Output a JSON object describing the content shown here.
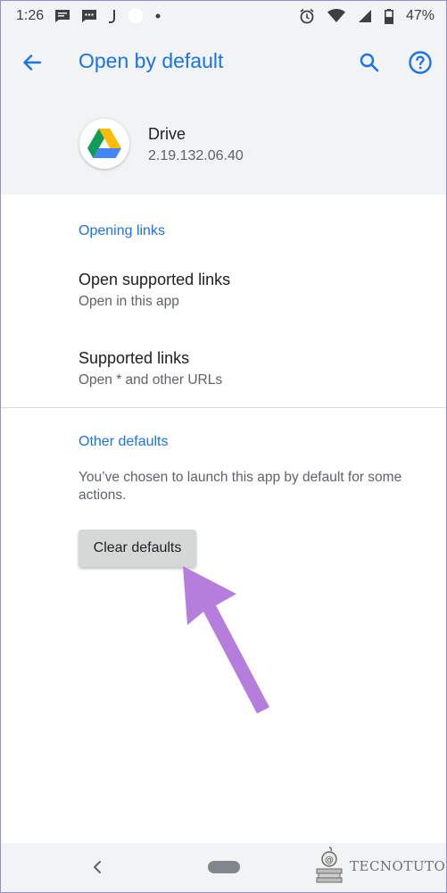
{
  "status_bar": {
    "time": "1:26",
    "battery": "47%",
    "icons": [
      "message-icon",
      "chat-icon",
      "j-icon",
      "circle-icon",
      "dot-icon",
      "alarm-icon",
      "wifi-icon",
      "signal-icon",
      "battery-icon"
    ]
  },
  "header": {
    "title": "Open by default"
  },
  "app": {
    "name": "Drive",
    "version": "2.19.132.06.40"
  },
  "sections": {
    "opening_links": {
      "header": "Opening links",
      "items": [
        {
          "title": "Open supported links",
          "summary": "Open in this app"
        },
        {
          "title": "Supported links",
          "summary": "Open * and other URLs"
        }
      ]
    },
    "other_defaults": {
      "header": "Other defaults",
      "description": "You’ve chosen to launch this app by default for some actions.",
      "button_label": "Clear defaults"
    }
  },
  "watermark": {
    "text": "TECNOTUTO"
  },
  "colors": {
    "accent": "#1a73e8",
    "header_bg": "#f1f3f4",
    "arrow": "#b57edc"
  }
}
